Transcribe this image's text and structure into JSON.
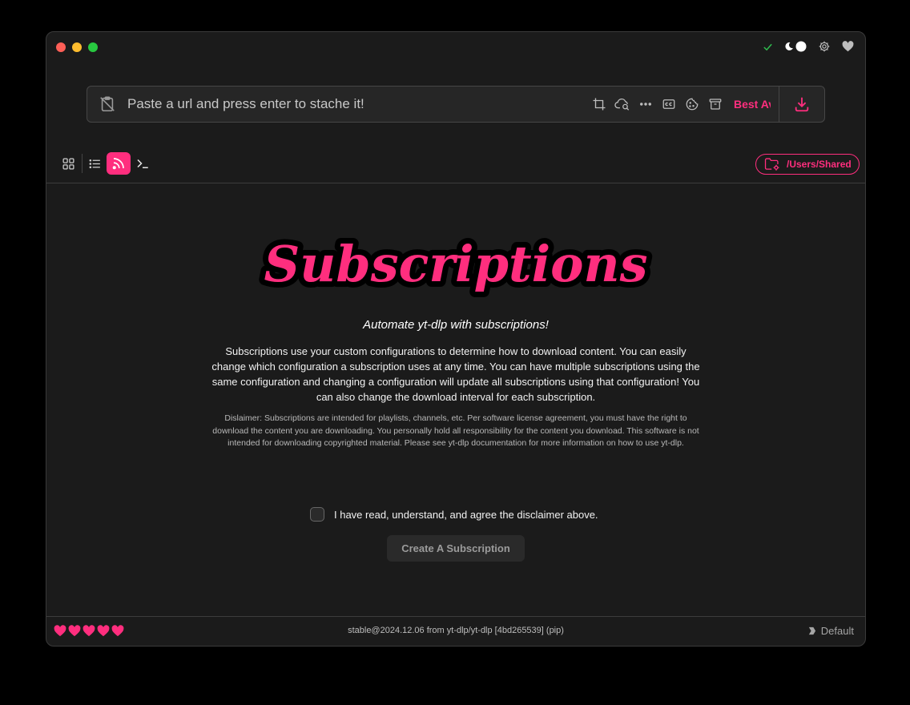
{
  "window": {
    "traffic_lights": [
      "close",
      "minimize",
      "zoom"
    ],
    "top_right_icons": [
      "check-icon",
      "theme-toggle",
      "gear-icon",
      "heart-icon"
    ]
  },
  "url_bar": {
    "placeholder": "Paste a url and press enter to stache it!",
    "tool_icons": [
      "crop-icon",
      "cloud-search-icon",
      "more-icon",
      "captions-icon",
      "cookie-icon",
      "archive-icon"
    ],
    "quality_label": "Best Av"
  },
  "view_tabs": [
    {
      "name": "grid",
      "active": false
    },
    {
      "name": "list",
      "active": false
    },
    {
      "name": "subscriptions",
      "active": true
    },
    {
      "name": "terminal",
      "active": false
    }
  ],
  "download_folder": "/Users/Shared/",
  "subscriptions_page": {
    "logo_text": "Subscriptions",
    "tagline": "Automate yt-dlp with subscriptions!",
    "description": "Subscriptions use your custom configurations to determine how to download content. You can easily change which configuration a subscription uses at any time. You can have multiple subscriptions using the same configuration and changing a configuration will update all subscriptions using that configuration! You can also change the download interval for each subscription.",
    "disclaimer": "Dislaimer: Subscriptions are intended for playlists, channels, etc. Per software license agreement, you must have the right to download the content you are downloading. You personally hold all responsibility for the content you download. This software is not intended for downloading copyrighted material. Please see yt-dlp documentation for more information on how to use yt-dlp.",
    "agree_label": "I have read, understand, and agree the disclaimer above.",
    "agree_checked": false,
    "create_button": "Create A Subscription"
  },
  "footer": {
    "hearts_count": 5,
    "version": "stable@2024.12.06 from yt-dlp/yt-dlp [4bd265539] (pip)",
    "profile": "Default"
  },
  "colors": {
    "accent": "#ff2e7e",
    "background": "#1b1b1b",
    "check_green": "#2fbf4f"
  }
}
